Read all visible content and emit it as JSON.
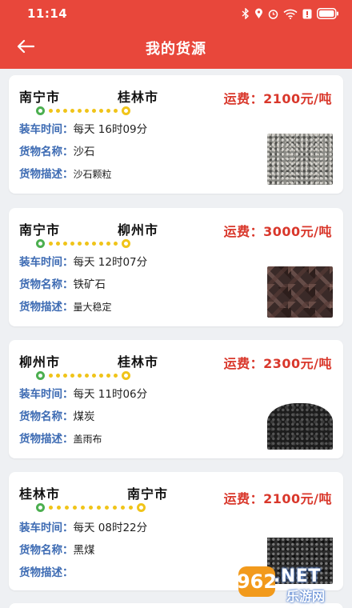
{
  "status_bar": {
    "time": "11:14",
    "icons": [
      "bluetooth-icon",
      "location-icon",
      "alarm-icon",
      "wifi-icon",
      "notification-icon",
      "battery-icon"
    ]
  },
  "header": {
    "title": "我的货源",
    "back_icon": "arrow-left-icon"
  },
  "colors": {
    "header_bg": "#e8473b",
    "fare": "#d9372b",
    "label": "#3d6bb3",
    "route_start": "#4caf50",
    "route_dots": "#f0c419"
  },
  "labels": {
    "load_time": "装车时间：",
    "cargo_name": "货物名称：",
    "cargo_desc": "货物描述："
  },
  "cards": [
    {
      "from": "南宁市",
      "to": "桂林市",
      "fare": "运费：2100元/吨",
      "load_time": "每天 16时09分",
      "cargo_name": "沙石",
      "cargo_desc": "沙石颗粒",
      "image": "gravel-photo"
    },
    {
      "from": "南宁市",
      "to": "柳州市",
      "fare": "运费：3000元/吨",
      "load_time": "每天 12时07分",
      "cargo_name": "铁矿石",
      "cargo_desc": "量大稳定",
      "image": "iron-ore-photo"
    },
    {
      "from": "柳州市",
      "to": "桂林市",
      "fare": "运费：2300元/吨",
      "load_time": "每天 11时06分",
      "cargo_name": "煤炭",
      "cargo_desc": "盖雨布",
      "image": "coal-pile-photo"
    },
    {
      "from": "桂林市",
      "to": "南宁市",
      "fare": "运费：2100元/吨",
      "load_time": "每天 08时22分",
      "cargo_name": "黑煤",
      "cargo_desc": "",
      "image": "black-coal-photo"
    }
  ],
  "watermark": {
    "number": "962",
    "suffix": ".NET",
    "site": "乐游网"
  }
}
